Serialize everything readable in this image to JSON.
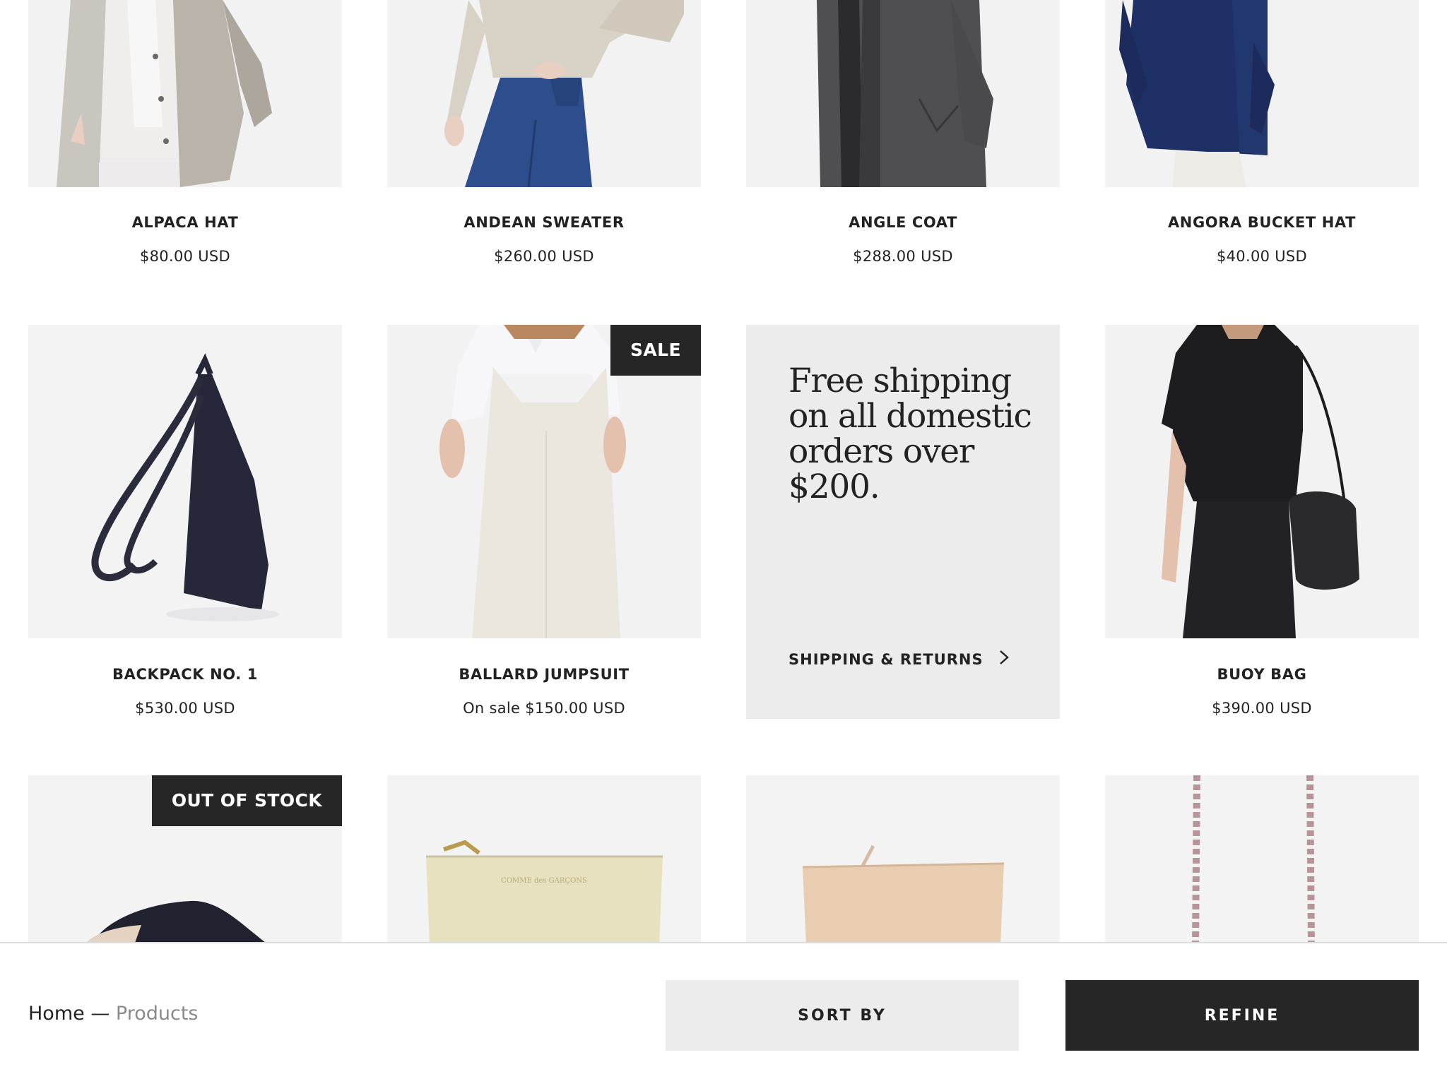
{
  "products": {
    "row1": [
      {
        "title": "ALPACA HAT",
        "price": "$80.00 USD"
      },
      {
        "title": "ANDEAN SWEATER",
        "price": "$260.00 USD"
      },
      {
        "title": "ANGLE COAT",
        "price": "$288.00 USD"
      },
      {
        "title": "ANGORA BUCKET HAT",
        "price": "$40.00 USD"
      }
    ],
    "row2": [
      {
        "title": "BACKPACK NO. 1",
        "price": "$530.00 USD"
      },
      {
        "title": "BALLARD JUMPSUIT",
        "price": "On sale $150.00 USD",
        "badge": "SALE"
      },
      {
        "title": "BUOY BAG",
        "price": "$390.00 USD"
      }
    ],
    "row3": [
      {
        "badge": "OUT OF STOCK"
      },
      {
        "brand_print": "COMME des GARÇONS"
      }
    ]
  },
  "promo": {
    "text": "Free shipping on all domestic orders over $200.",
    "link_label": "SHIPPING & RETURNS"
  },
  "bottombar": {
    "breadcrumb_home": "Home",
    "breadcrumb_sep": " — ",
    "breadcrumb_current": "Products",
    "sort_label": "SORT BY",
    "refine_label": "REFINE"
  },
  "colors": {
    "dark": "#262626",
    "panel": "#ececec",
    "text": "#222222",
    "muted": "#8a8a8a"
  },
  "icons": [
    "chevron-right-icon"
  ]
}
